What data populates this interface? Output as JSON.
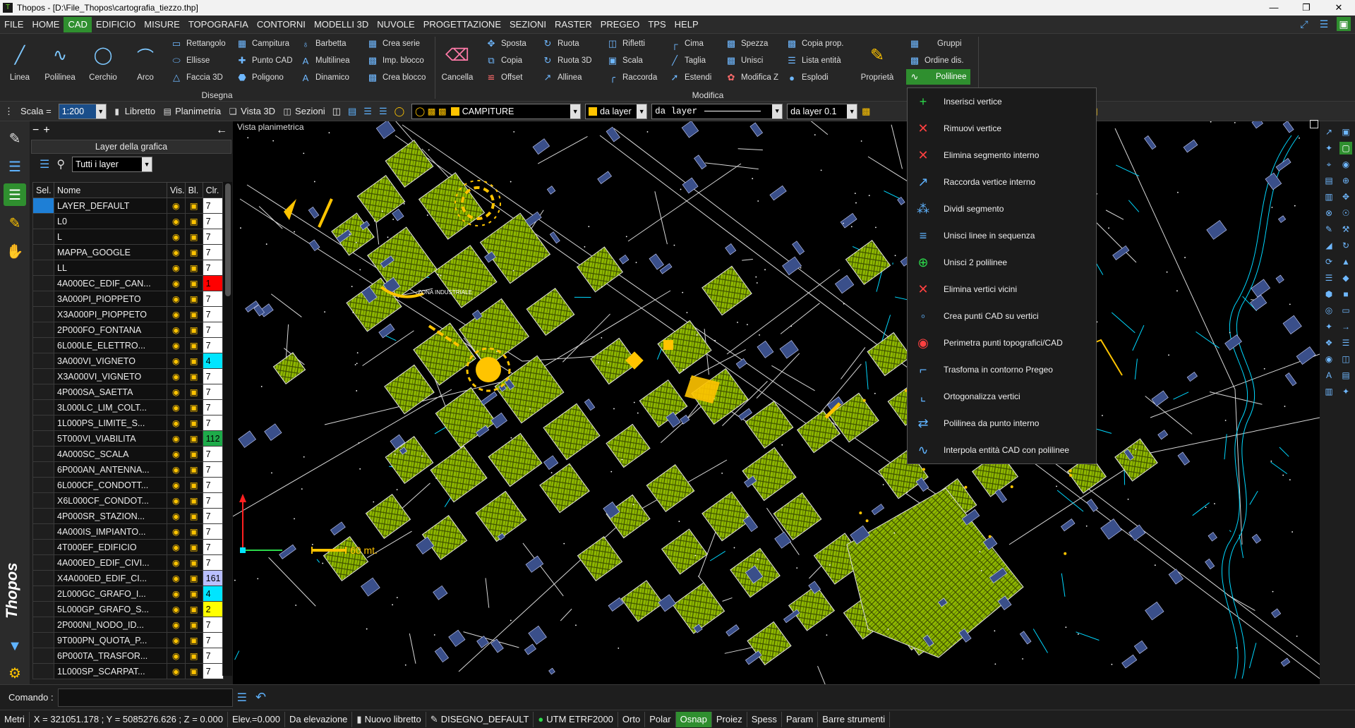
{
  "window": {
    "title": "Thopos - [D:\\File_Thopos\\cartografia_tiezzo.thp]"
  },
  "menu": {
    "items": [
      "FILE",
      "HOME",
      "CAD",
      "EDIFICIO",
      "MISURE",
      "TOPOGRAFIA",
      "CONTORNI",
      "MODELLI 3D",
      "NUVOLE",
      "PROGETTAZIONE",
      "SEZIONI",
      "RASTER",
      "PREGEO",
      "TPS",
      "HELP"
    ],
    "active": "CAD"
  },
  "ribbon": {
    "disegna": {
      "label": "Disegna",
      "big": [
        "Linea",
        "Polilinea",
        "Cerchio",
        "Arco"
      ],
      "small": [
        "Rettangolo",
        "Ellisse",
        "Faccia 3D",
        "Campitura",
        "Punto CAD",
        "Poligono",
        "Barbetta",
        "Multilinea",
        "Dinamico",
        "Crea serie",
        "Imp. blocco",
        "Crea blocco"
      ]
    },
    "modifica": {
      "label": "Modifica",
      "big": [
        "Cancella",
        "Proprietà"
      ],
      "small": [
        "Sposta",
        "Copia",
        "Offset",
        "Ruota",
        "Ruota 3D",
        "Allinea",
        "Rifletti",
        "Scala",
        "Raccorda",
        "Cima",
        "Taglia",
        "Estendi",
        "Spezza",
        "Unisci",
        "Modifica Z",
        "Copia prop.",
        "Lista entità",
        "Esplodi",
        "Gruppi",
        "Ordine dis.",
        "Polilinee"
      ]
    }
  },
  "toolbar": {
    "scala_label": "Scala =",
    "scala_value": "1:200",
    "libretto": "Libretto",
    "planimetria": "Planimetria",
    "vista3d": "Vista 3D",
    "sezioni": "Sezioni",
    "layer_current": "CAMPITURE",
    "color_mode": "da layer",
    "linetype": "da layer",
    "lineweight": "da layer 0.1"
  },
  "layer_panel": {
    "title": "Layer della grafica",
    "filter": "Tutti i layer",
    "columns": {
      "sel": "Sel.",
      "name": "Nome",
      "vis": "Vis.",
      "bl": "Bl.",
      "clr": "Clr."
    },
    "rows": [
      {
        "name": "LAYER_DEFAULT",
        "clr": "7",
        "sel_color": "#1e7fd6",
        "clr_bg": "#ffffff"
      },
      {
        "name": "L0",
        "clr": "7",
        "clr_bg": "#ffffff"
      },
      {
        "name": "L",
        "clr": "7",
        "clr_bg": "#ffffff"
      },
      {
        "name": "MAPPA_GOOGLE",
        "clr": "7",
        "clr_bg": "#ffffff"
      },
      {
        "name": "LL",
        "clr": "7",
        "clr_bg": "#ffffff"
      },
      {
        "name": "4A000EC_EDIF_CAN...",
        "clr": "1",
        "clr_bg": "#ff0000"
      },
      {
        "name": "3A000PI_PIOPPETO",
        "clr": "7",
        "clr_bg": "#ffffff"
      },
      {
        "name": "X3A000PI_PIOPPETO",
        "clr": "7",
        "clr_bg": "#ffffff"
      },
      {
        "name": "2P000FO_FONTANA",
        "clr": "7",
        "clr_bg": "#ffffff"
      },
      {
        "name": "6L000LE_ELETTRO...",
        "clr": "7",
        "clr_bg": "#ffffff"
      },
      {
        "name": "3A000VI_VIGNETO",
        "clr": "4",
        "clr_bg": "#00e5ff"
      },
      {
        "name": "X3A000VI_VIGNETO",
        "clr": "7",
        "clr_bg": "#ffffff"
      },
      {
        "name": "4P000SA_SAETTA",
        "clr": "7",
        "clr_bg": "#ffffff"
      },
      {
        "name": "3L000LC_LIM_COLT...",
        "clr": "7",
        "clr_bg": "#ffffff"
      },
      {
        "name": "1L000PS_LIMITE_S...",
        "clr": "7",
        "clr_bg": "#ffffff"
      },
      {
        "name": "5T000VI_VIABILITA",
        "clr": "112",
        "clr_bg": "#1eab4a"
      },
      {
        "name": "4A000SC_SCALA",
        "clr": "7",
        "clr_bg": "#ffffff"
      },
      {
        "name": "6P000AN_ANTENNA...",
        "clr": "7",
        "clr_bg": "#ffffff"
      },
      {
        "name": "6L000CF_CONDOTT...",
        "clr": "7",
        "clr_bg": "#ffffff"
      },
      {
        "name": "X6L000CF_CONDOT...",
        "clr": "7",
        "clr_bg": "#ffffff"
      },
      {
        "name": "4P000SR_STAZION...",
        "clr": "7",
        "clr_bg": "#ffffff"
      },
      {
        "name": "4A000IS_IMPIANTO...",
        "clr": "7",
        "clr_bg": "#ffffff"
      },
      {
        "name": "4T000EF_EDIFICIO",
        "clr": "7",
        "clr_bg": "#ffffff"
      },
      {
        "name": "4A000ED_EDIF_CIVI...",
        "clr": "7",
        "clr_bg": "#ffffff"
      },
      {
        "name": "X4A000ED_EDIF_CI...",
        "clr": "161",
        "clr_bg": "#b9bfff"
      },
      {
        "name": "2L000GC_GRAFO_I...",
        "clr": "4",
        "clr_bg": "#00e5ff"
      },
      {
        "name": "5L000GP_GRAFO_S...",
        "clr": "2",
        "clr_bg": "#ffff00"
      },
      {
        "name": "2P000NI_NODO_ID...",
        "clr": "7",
        "clr_bg": "#ffffff"
      },
      {
        "name": "9T000PN_QUOTA_P...",
        "clr": "7",
        "clr_bg": "#ffffff"
      },
      {
        "name": "6P000TA_TRASFOR...",
        "clr": "7",
        "clr_bg": "#ffffff"
      },
      {
        "name": "1L000SP_SCARPAT...",
        "clr": "7",
        "clr_bg": "#ffffff"
      }
    ]
  },
  "view": {
    "label": "Vista planimetrica",
    "map_text": "ZONA INDUSTRIALE",
    "scale_bar": "60 mt."
  },
  "polilinee_menu": {
    "items": [
      {
        "label": "Inserisci vertice",
        "icon": "insert-vertex-icon"
      },
      {
        "label": "Rimuovi vertice",
        "icon": "remove-vertex-icon"
      },
      {
        "label": "Elimina segmento interno",
        "icon": "delete-segment-icon"
      },
      {
        "label": "Raccorda vertice interno",
        "icon": "fillet-vertex-icon"
      },
      {
        "label": "Dividi segmento",
        "icon": "split-segment-icon"
      },
      {
        "label": "Unisci linee in sequenza",
        "icon": "join-lines-icon"
      },
      {
        "label": "Unisci 2 polilinee",
        "icon": "join-polylines-icon"
      },
      {
        "label": "Elimina vertici vicini",
        "icon": "delete-near-vertices-icon"
      },
      {
        "label": "Crea punti CAD su vertici",
        "icon": "cad-points-icon"
      },
      {
        "label": "Perimetra punti topografici/CAD",
        "icon": "perimeter-icon"
      },
      {
        "label": "Trasfoma in contorno Pregeo",
        "icon": "pregeo-contour-icon"
      },
      {
        "label": "Ortogonalizza vertici",
        "icon": "orthogonalize-icon"
      },
      {
        "label": "Polilinea da punto interno",
        "icon": "polyline-inner-icon"
      },
      {
        "label": "Interpola entità CAD con polilinee",
        "icon": "interpolate-icon"
      }
    ]
  },
  "command": {
    "label": "Comando :",
    "value": ""
  },
  "status": {
    "units": "Metri",
    "coords": "X = 321051.178 ; Y = 5085276.626 ; Z = 0.000",
    "elev": "Elev.=0.000",
    "elev_mode": "Da elevazione",
    "libretto": "Nuovo libretto",
    "drawing": "DISEGNO_DEFAULT",
    "crs": "UTM ETRF2000",
    "toggles": [
      "Orto",
      "Polar",
      "Osnap",
      "Proiez",
      "Spess",
      "Param",
      "Barre strumenti"
    ],
    "active_toggle": "Osnap"
  },
  "brand": "Thopos",
  "colors": {
    "accent": "#2f8f2f",
    "hatch": "#8fb800",
    "road": "#ffc400",
    "map_bg": "#000000"
  }
}
